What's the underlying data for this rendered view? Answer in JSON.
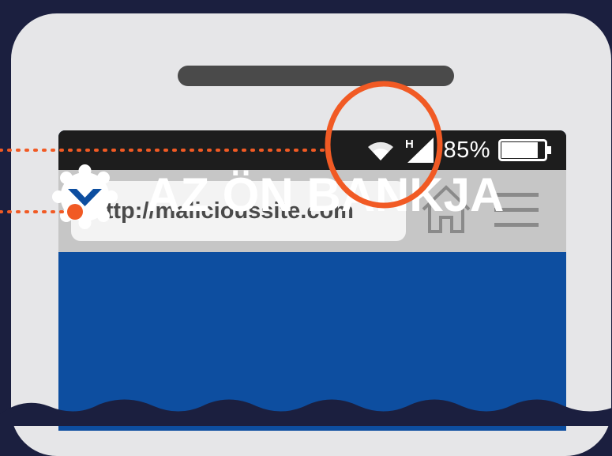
{
  "status_bar": {
    "network_type": "H",
    "battery_percent": "85%",
    "battery_level": 0.85
  },
  "browser": {
    "url": "http://malicioussite.com",
    "home_icon": "home-icon",
    "menu_icon": "hamburger-menu-icon"
  },
  "page": {
    "bank_name": "AZ ÖN BANKJA",
    "logo_icon": "bank-logo-icon"
  },
  "colors": {
    "background": "#1b1f3f",
    "phone_body": "#e6e6e8",
    "status_bar": "#1d1d1d",
    "browser_bar": "#c6c6c6",
    "bank_blue": "#0d4ea0",
    "highlight_orange": "#f15a24"
  }
}
